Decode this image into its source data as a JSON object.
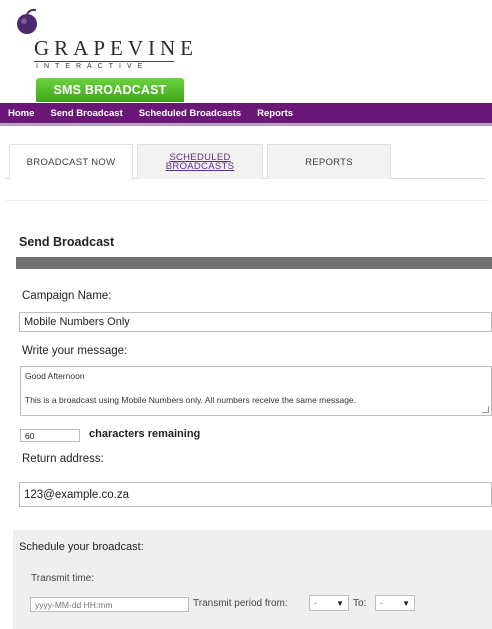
{
  "branding": {
    "logo_word": "GRAPEVINE",
    "logo_sub": "INTERACTIVE",
    "product_badge": "SMS BROADCAST",
    "accent_purple": "#6a1676",
    "accent_green": "#4cb527"
  },
  "nav": {
    "items": [
      "Home",
      "Send Broadcast",
      "Scheduled Broadcasts",
      "Reports"
    ]
  },
  "tabs": [
    {
      "label": "BROADCAST NOW",
      "active": true
    },
    {
      "label": "SCHEDULED BROADCASTS",
      "line1": "SCHEDULED",
      "line2": "BROADCASTS",
      "active": false
    },
    {
      "label": "REPORTS",
      "active": false
    }
  ],
  "form": {
    "section_title": "Send Broadcast",
    "campaign_label": "Campaign Name:",
    "campaign_value": "Mobile Numbers Only",
    "message_label": "Write your message:",
    "message_value": "Good Afternoon\n\nThis is a broadcast using Mobile Numbers only. All numbers receive the same message.",
    "chars_value": "60",
    "chars_label": "characters remaining",
    "return_label": "Return address:",
    "return_value": "123@example.co.za"
  },
  "schedule": {
    "title": "Schedule your broadcast:",
    "transmit_time_label": "Transmit time:",
    "transmit_time_placeholder": "yyyy-MM-dd HH:mm",
    "period_from_label": "Transmit period from:",
    "period_from_value": "-",
    "to_label": "To:",
    "to_value": "-"
  }
}
